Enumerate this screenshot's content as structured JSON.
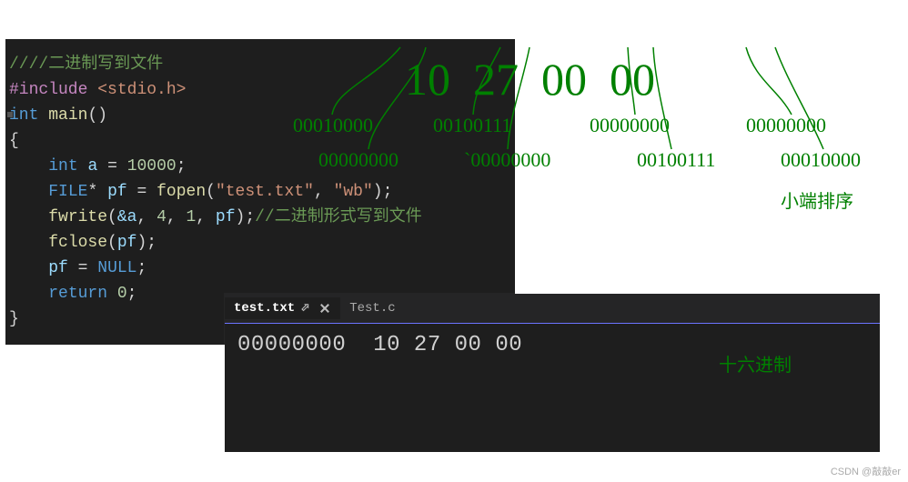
{
  "hex_header": [
    "10",
    "27",
    "00",
    "00"
  ],
  "bin_row1": [
    "00010000",
    "00100111",
    "00000000",
    "00000000"
  ],
  "bin_row2": [
    "00000000",
    "`00000000",
    "00100111",
    "00010000"
  ],
  "annot_right_top": "小端排序",
  "hex_label": "十六进制",
  "code": {
    "comment_top": "////二进制写到文件",
    "include_kw": "#include",
    "include_hdr": "<stdio.h>",
    "int_kw": "int",
    "main_func": "main",
    "a_var": "a",
    "a_val": "10000",
    "file_type": "FILE",
    "pf_var": "pf",
    "fopen_func": "fopen",
    "fopen_arg1": "\"test.txt\"",
    "fopen_arg2": "\"wb\"",
    "fwrite_func": "fwrite",
    "fwrite_a": "&a",
    "fwrite_n1": "4",
    "fwrite_n2": "1",
    "fwrite_comment": "//二进制形式写到文件",
    "fclose_func": "fclose",
    "null_kw": "NULL",
    "return_kw": "return",
    "return_val": "0"
  },
  "tabs": {
    "active": "test.txt",
    "other": "Test.c"
  },
  "hex_view": {
    "offset": "00000000",
    "bytes": "10 27 00 00"
  },
  "watermark": "CSDN @敲敲er"
}
